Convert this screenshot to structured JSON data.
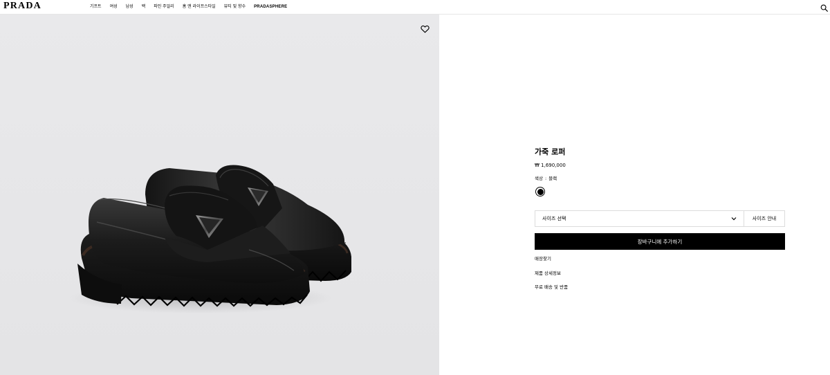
{
  "header": {
    "logo": "PRADA",
    "nav": [
      "기프트",
      "여성",
      "남성",
      "백",
      "파인 주얼리",
      "홈 앤 라이프스타일",
      "뷰티 및 향수",
      "PRADASPHERE"
    ]
  },
  "icons": {
    "search": "search-icon",
    "wishlist": "heart-icon",
    "dropdown": "chevron-down-icon"
  },
  "product": {
    "name": "가죽 로퍼",
    "price": "₩ 1,690,000",
    "color_label": "색상",
    "color_value": "블랙",
    "color_hex": "#000000",
    "size_placeholder": "사이즈 선택",
    "size_guide": "사이즈 안내",
    "add_to_cart": "장바구니에 추가하기",
    "links": [
      "매장찾기",
      "제품 상세정보",
      "무료 배송 및 반품"
    ]
  },
  "colors": {
    "image_bg": "#e7e7e9",
    "button_bg": "#000000"
  }
}
